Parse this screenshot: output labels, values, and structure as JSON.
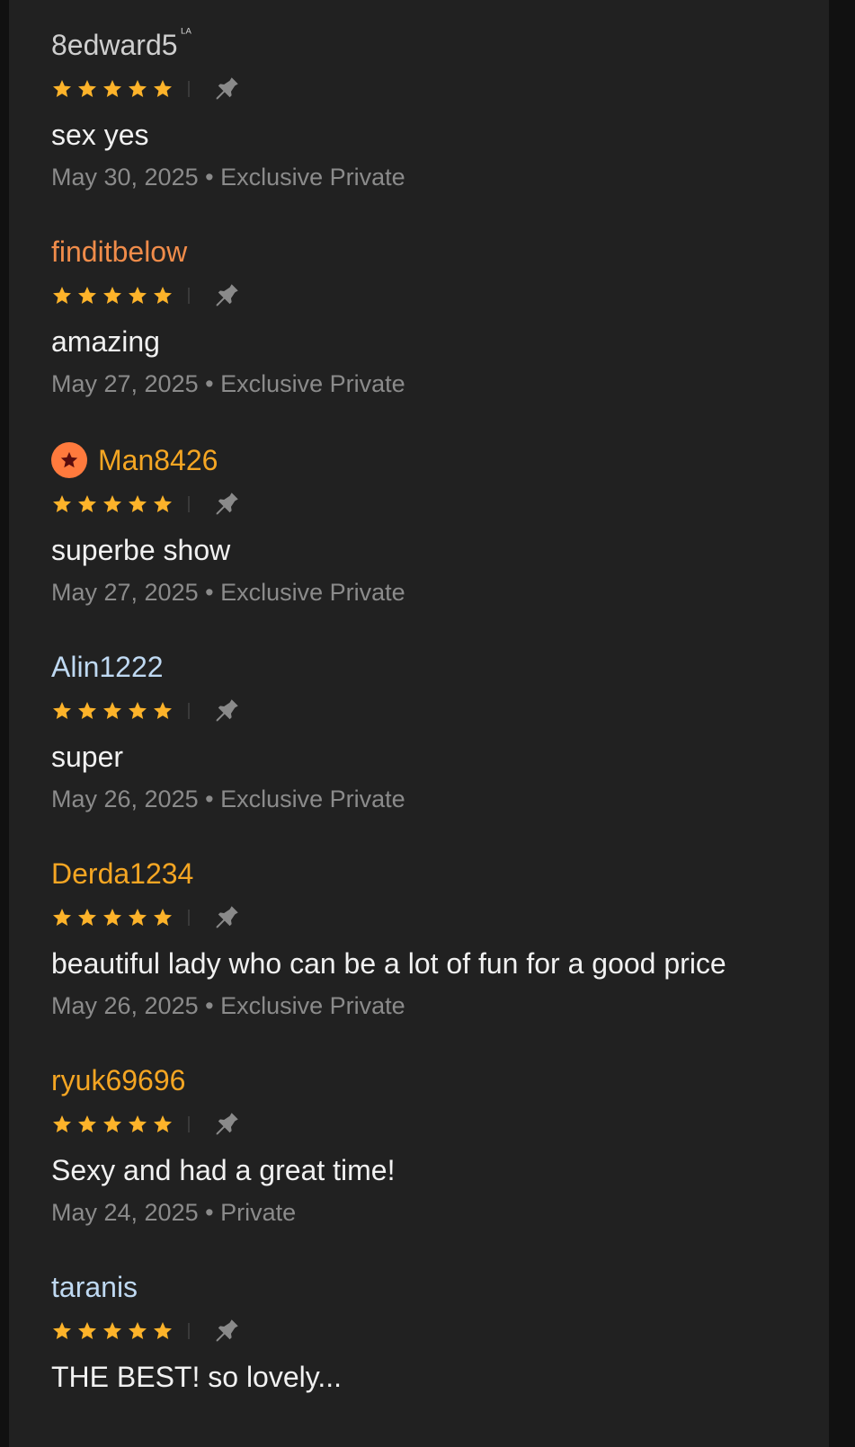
{
  "colors": {
    "star": "#FDB32A",
    "pin": "#8a8a8a",
    "badge_bg": "#FF7A3D",
    "badge_icon": "#5a0d0d"
  },
  "reviews": [
    {
      "username": "8edward5",
      "username_color": "#cfcfcf",
      "crown_mark": "ᴸᴬ",
      "rating": 5,
      "comment": "sex yes",
      "date": "May 30, 2025",
      "separator": "•",
      "type": "Exclusive Private"
    },
    {
      "username": "finditbelow",
      "username_color": "#F08C4A",
      "rating": 5,
      "comment": "amazing",
      "date": "May 27, 2025",
      "separator": "•",
      "type": "Exclusive Private"
    },
    {
      "username": "Man8426",
      "username_color": "#F5A623",
      "badge": "star-badge-icon",
      "rating": 5,
      "comment": "superbe show",
      "date": "May 27, 2025",
      "separator": "•",
      "type": "Exclusive Private"
    },
    {
      "username": "Alin1222",
      "username_color": "#BFD9F2",
      "rating": 5,
      "comment": "super",
      "date": "May 26, 2025",
      "separator": "•",
      "type": "Exclusive Private"
    },
    {
      "username": "Derda1234",
      "username_color": "#F5A623",
      "rating": 5,
      "comment": "beautiful lady who can be a lot of fun for a good price",
      "date": "May 26, 2025",
      "separator": "•",
      "type": "Exclusive Private"
    },
    {
      "username": "ryuk69696",
      "username_color": "#F5A623",
      "rating": 5,
      "comment": "Sexy and had a great time!",
      "date": "May 24, 2025",
      "separator": "•",
      "type": "Private"
    },
    {
      "username": "taranis",
      "username_color": "#BFD9F2",
      "rating": 5,
      "comment": "THE BEST! so lovely...",
      "date": "",
      "separator": "",
      "type": ""
    }
  ]
}
